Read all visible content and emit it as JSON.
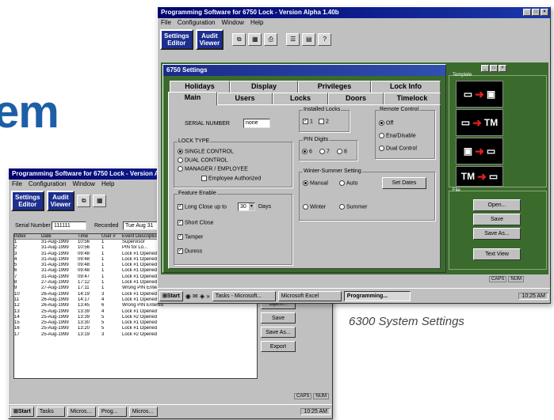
{
  "headline_fragment": "em",
  "caption": "6300 System Settings",
  "front_window": {
    "title": "Programming Software for 6750 Lock - Version Alpha 1.40b",
    "menu": [
      "File",
      "Configuration",
      "Window",
      "Help"
    ],
    "toolbar": {
      "settings_editor": "Settings\nEditor",
      "audit_viewer": "Audit\nViewer",
      "icons": [
        "copy-icon",
        "grid-icon",
        "print-icon",
        "list-icon",
        "help-icon"
      ],
      "help_label": "?"
    },
    "dialog": {
      "title": "6750 Settings",
      "tabs_back": [
        "Holidays",
        "Display",
        "Privileges",
        "Lock Info"
      ],
      "tabs_front": [
        "Main",
        "Users",
        "Locks",
        "Doors",
        "Timelock"
      ],
      "serial_number_label": "SERIAL NUMBER",
      "serial_number_value": "none",
      "lock_type": {
        "title": "LOCK TYPE",
        "options": [
          "SINGLE CONTROL",
          "DUAL CONTROL",
          "MANAGER / EMPLOYEE"
        ],
        "selected": 0,
        "employee_authorized": "Employee Authorized"
      },
      "installed_locks": {
        "title": "Installed Locks",
        "options": [
          "1",
          "2"
        ]
      },
      "pin_digits": {
        "title": "PIN Digits",
        "options": [
          "6",
          "7",
          "8"
        ],
        "selected": 0
      },
      "remote_control": {
        "title": "Remote Control",
        "options": [
          "Off",
          "Ena/Disable",
          "Dual Control"
        ],
        "selected": 0
      },
      "feature_enable": {
        "title": "Feature Enable",
        "long_close_label": "Long Close up to",
        "long_close_value": "30",
        "days_label": "Days",
        "items": [
          "Short Close",
          "Tamper",
          "Duress"
        ]
      },
      "winter_summer": {
        "title": "Winter-Summer Setting",
        "options": [
          "Manual",
          "Auto"
        ],
        "selected": 0,
        "set_dates": "Set Dates",
        "winter": "Winter",
        "summer": "Summer"
      }
    },
    "side_panel": {
      "template_label": "Template",
      "file_label": "File",
      "buttons": [
        "Open...",
        "Save",
        "Save As...",
        "Text View"
      ]
    },
    "status": {
      "caps": "CAPS",
      "num": "NUM"
    },
    "taskbar": {
      "start": "Start",
      "items": [
        "Tasks - Microsoft...",
        "Microsoft Excel",
        "Programming..."
      ],
      "clock": "10:25 AM"
    }
  },
  "back_window": {
    "title": "Programming Software for 6750 Lock - Version Alpha 1.40b",
    "menu": [
      "File",
      "Configuration",
      "Window",
      "Help"
    ],
    "toolbar": {
      "settings_editor": "Settings\nEditor",
      "audit_viewer": "Audit\nViewer"
    },
    "serial_label": "Serial Number",
    "serial_value": "111111",
    "recorded_label": "Recorded",
    "recorded_value": "Tue Aug 31",
    "columns": [
      "Index",
      "Date",
      "Time",
      "User #",
      "Event Description"
    ],
    "rows": [
      [
        "1",
        "31-Aug-1999",
        "10:56",
        "1",
        "Supervisor"
      ],
      [
        "2",
        "31-Aug-1999",
        "10:56",
        "1",
        "PIN for Lo..."
      ],
      [
        "3",
        "31-Aug-1999",
        "09:48",
        "1",
        "Lock #1 Opened"
      ],
      [
        "4",
        "31-Aug-1999",
        "09:48",
        "1",
        "Lock #1 Opened"
      ],
      [
        "5",
        "31-Aug-1999",
        "09:48",
        "1",
        "Lock #1 Opened"
      ],
      [
        "6",
        "31-Aug-1999",
        "09:48",
        "1",
        "Lock #1 Opened"
      ],
      [
        "7",
        "31-Aug-1999",
        "09:47",
        "1",
        "Lock #1 Opened"
      ],
      [
        "8",
        "27-Aug-1999",
        "17:12",
        "1",
        "Lock #1 Opened"
      ],
      [
        "9",
        "27-Aug-1999",
        "17:11",
        "1",
        "Wrong PIN Entered"
      ],
      [
        "10",
        "26-Aug-1999",
        "14:19",
        "3",
        "Lock #1 Opened"
      ],
      [
        "11",
        "26-Aug-1999",
        "14:17",
        "4",
        "Lock #1 Opened"
      ],
      [
        "12",
        "26-Aug-1999",
        "13:45",
        "6",
        "Wrong PIN Entered"
      ],
      [
        "13",
        "25-Aug-1999",
        "13:39",
        "4",
        "Lock #1 Opened"
      ],
      [
        "14",
        "25-Aug-1999",
        "13:39",
        "5",
        "Lock #2 Opened"
      ],
      [
        "15",
        "25-Aug-1999",
        "13:30",
        "5",
        "Lock #1 Opened"
      ],
      [
        "16",
        "25-Aug-1999",
        "13:20",
        "5",
        "Lock #1 Opened"
      ],
      [
        "17",
        "25-Aug-1999",
        "13:19",
        "3",
        "Lock #2 Opened"
      ]
    ],
    "side_buttons": [
      "Open...",
      "Save",
      "Save As...",
      "Export"
    ],
    "status": {
      "caps": "CAPS",
      "num": "NUM"
    },
    "taskbar": {
      "start": "Start",
      "items": [
        "Tasks",
        "Micros...",
        "Prog...",
        "Micros..."
      ],
      "clock": "10:25 AM"
    }
  },
  "colors": {
    "accent_blue": "#1c5fa6",
    "title_bar": "#00006e",
    "panel_green": "#3a6b2c"
  }
}
